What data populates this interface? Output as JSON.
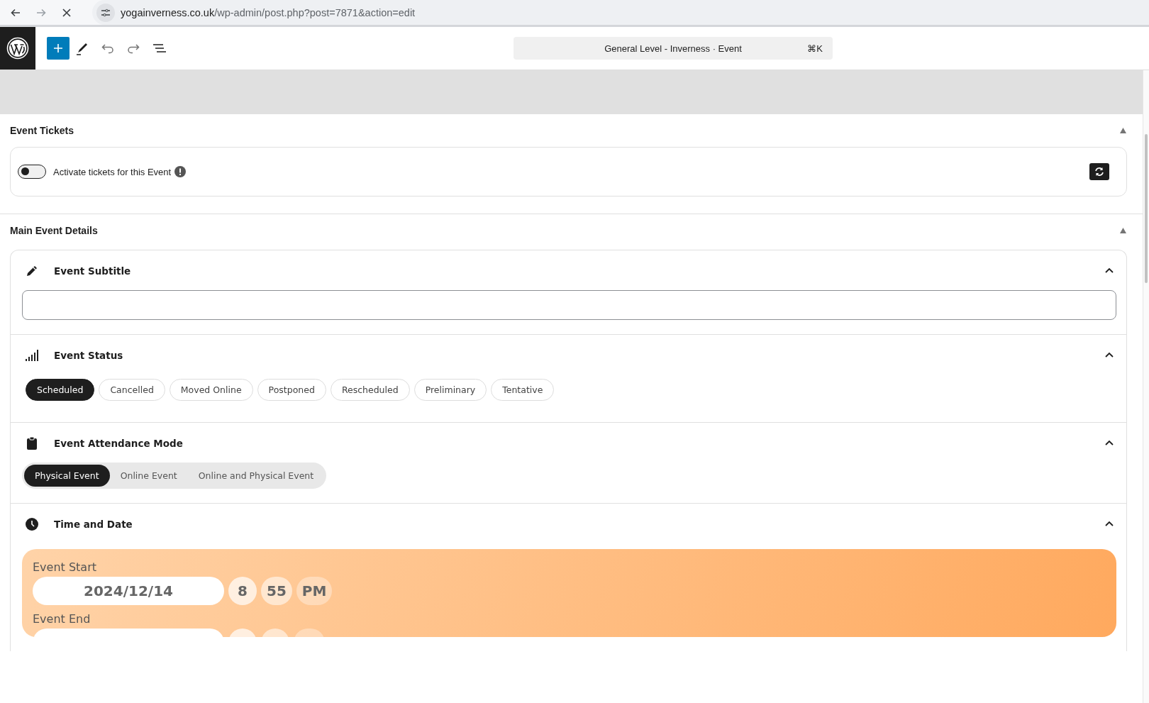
{
  "browser": {
    "url_host": "yogainverness.co.uk",
    "url_path": "/wp-admin/post.php?post=7871&action=edit"
  },
  "toolbar": {
    "document_title": "General Level - Inverness · Event",
    "shortcut": "⌘K"
  },
  "tickets_panel": {
    "title": "Event Tickets",
    "expanded": true,
    "toggle": {
      "label": "Activate tickets for this Event",
      "on": false
    }
  },
  "details_panel": {
    "title": "Main Event Details",
    "expanded": true,
    "sections": [
      {
        "kind": "text_input",
        "title": "Event Subtitle",
        "expanded": true
      },
      {
        "kind": "chips",
        "title": "Event Status",
        "expanded": true,
        "options": [
          {
            "label": "Scheduled",
            "selected": true
          },
          {
            "label": "Cancelled",
            "selected": false
          },
          {
            "label": "Moved Online",
            "selected": false
          },
          {
            "label": "Postponed",
            "selected": false
          },
          {
            "label": "Rescheduled",
            "selected": false
          },
          {
            "label": "Preliminary",
            "selected": false
          },
          {
            "label": "Tentative",
            "selected": false
          }
        ]
      },
      {
        "kind": "segmented",
        "title": "Event Attendance Mode",
        "expanded": true,
        "options": [
          {
            "label": "Physical Event",
            "selected": true
          },
          {
            "label": "Online Event",
            "selected": false
          },
          {
            "label": "Online and Physical Event",
            "selected": false
          }
        ]
      },
      {
        "kind": "datetime",
        "title": "Time and Date",
        "expanded": true,
        "rows": [
          {
            "label": "Event Start",
            "date": "2024/12/14",
            "hour": "8",
            "minute": "55",
            "ampm": "PM"
          },
          {
            "label": "Event End"
          }
        ]
      }
    ]
  }
}
